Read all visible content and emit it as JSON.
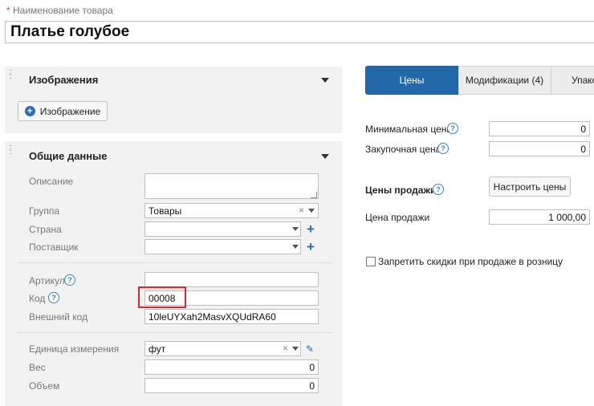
{
  "product": {
    "name_label_star": "*",
    "name_label": "Наименование товара",
    "name_value": "Платье голубое"
  },
  "images_section": {
    "title": "Изображения",
    "add_button": "Изображение"
  },
  "general_section": {
    "title": "Общие данные",
    "description_label": "Описание",
    "description_value": "",
    "group_label": "Группа",
    "group_value": "Товары",
    "country_label": "Страна",
    "country_value": "",
    "supplier_label": "Поставщик",
    "supplier_value": "",
    "article_label": "Артикул",
    "article_value": "",
    "code_label": "Код",
    "code_value": "00008",
    "external_code_label": "Внешний код",
    "external_code_value": "10leUYXah2MasvXQUdRA60",
    "unit_label": "Единица измерения",
    "unit_value": "фут",
    "weight_label": "Вес",
    "weight_value": "0",
    "volume_label": "Объем",
    "volume_value": "0"
  },
  "tabs": [
    {
      "label": "Цены",
      "active": true
    },
    {
      "label": "Модификации (4)",
      "active": false
    },
    {
      "label": "Упако",
      "active": false
    }
  ],
  "prices": {
    "min_price_label": "Минимальная цена",
    "min_price_value": "0",
    "purchase_price_label": "Закупочная цена",
    "purchase_price_value": "0",
    "sale_prices_title": "Цены продажи",
    "configure_button": "Настроить цены",
    "sale_price_label": "Цена продажи",
    "sale_price_value": "1 000,00",
    "forbid_discount_label": "Запретить скидки при продаже в розницу",
    "forbid_discount_checked": false
  },
  "icons": {
    "help": "help-circle-icon",
    "drag": "drag-handle-icon",
    "add": "plus-icon",
    "clear": "clear-x-icon",
    "edit": "pencil-icon"
  },
  "colors": {
    "accent": "#2369a9",
    "highlight": "#e0262d",
    "required": "#e0452f"
  }
}
